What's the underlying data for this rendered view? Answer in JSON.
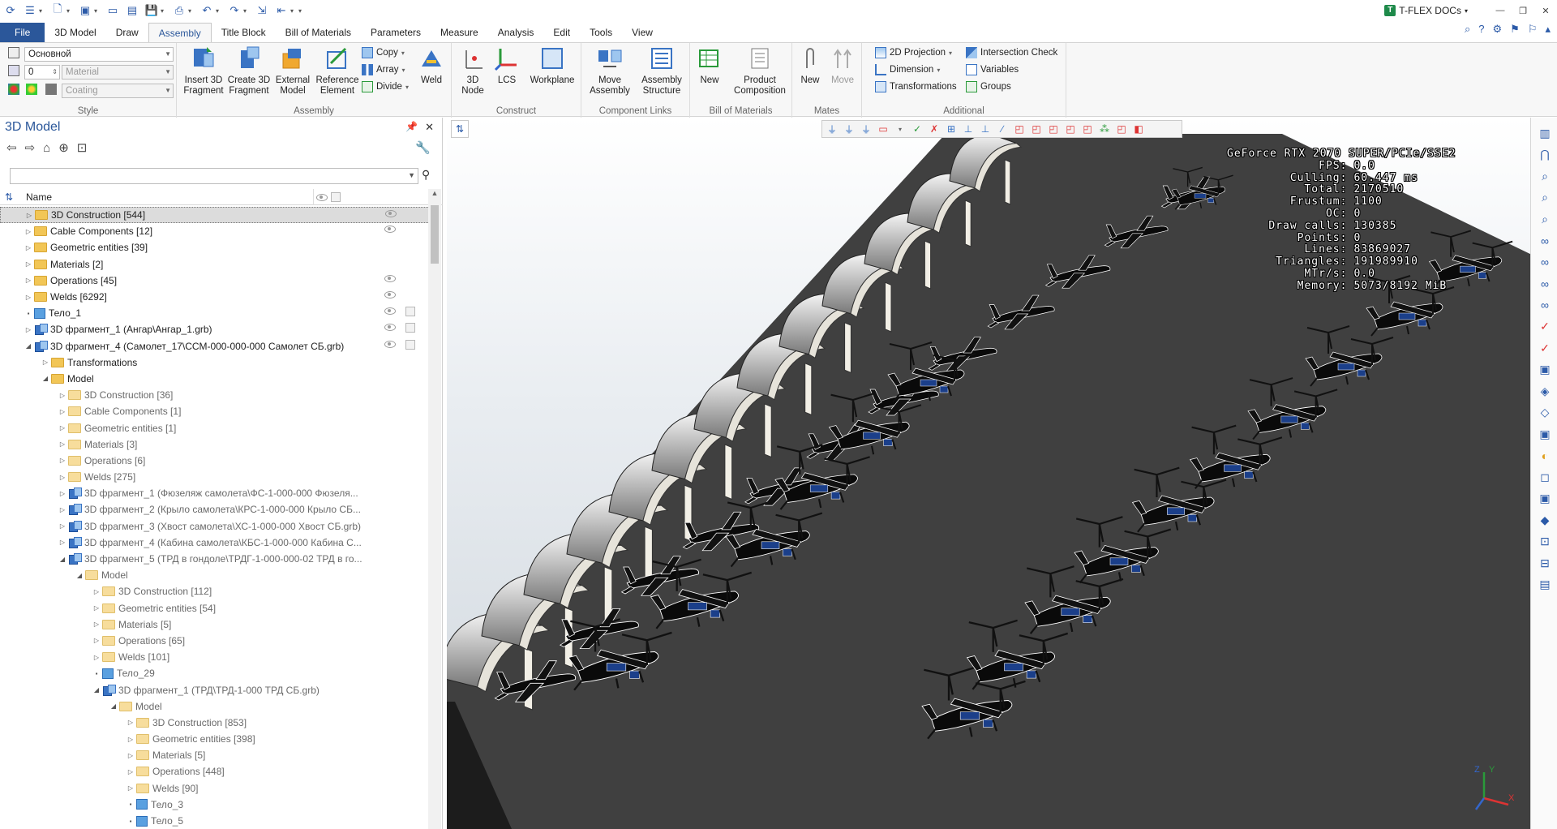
{
  "app": {
    "brand": "T-FLEX DOCs",
    "accent": "#2b579a"
  },
  "menu_tabs": [
    {
      "label": "File",
      "kind": "file"
    },
    {
      "label": "3D Model",
      "kind": ""
    },
    {
      "label": "Draw",
      "kind": ""
    },
    {
      "label": "Assembly",
      "kind": "active"
    },
    {
      "label": "Title Block",
      "kind": ""
    },
    {
      "label": "Bill of Materials",
      "kind": ""
    },
    {
      "label": "Parameters",
      "kind": ""
    },
    {
      "label": "Measure",
      "kind": ""
    },
    {
      "label": "Analysis",
      "kind": ""
    },
    {
      "label": "Edit",
      "kind": ""
    },
    {
      "label": "Tools",
      "kind": ""
    },
    {
      "label": "View",
      "kind": ""
    }
  ],
  "ribbon": {
    "style": {
      "group_label": "Style",
      "layer_value": "Основной",
      "level_value": "0",
      "material_placeholder": "Material",
      "coating_placeholder": "Coating"
    },
    "assembly": {
      "group_label": "Assembly",
      "insert_3d_fragment": "Insert 3D Fragment",
      "create_3d_fragment": "Create 3D Fragment",
      "external_model": "External Model",
      "reference_element": "Reference Element",
      "copy": "Copy",
      "array": "Array",
      "divide": "Divide",
      "weld": "Weld"
    },
    "construct": {
      "group_label": "Construct",
      "node_3d": "3D Node",
      "lcs": "LCS",
      "workplane": "Workplane"
    },
    "component_links": {
      "group_label": "Component Links",
      "move_assembly": "Move Assembly",
      "assembly_structure": "Assembly Structure"
    },
    "bill_of_materials": {
      "group_label": "Bill of Materials",
      "new": "New",
      "product_composition": "Product Composition"
    },
    "mates": {
      "group_label": "Mates",
      "new": "New",
      "move": "Move"
    },
    "additional": {
      "group_label": "Additional",
      "projection_2d": "2D Projection",
      "dimension": "Dimension",
      "transformations": "Transformations",
      "intersection_check": "Intersection Check",
      "variables": "Variables",
      "groups": "Groups"
    }
  },
  "model_panel": {
    "title": "3D Model",
    "column_name": "Name",
    "tree": [
      {
        "depth": 0,
        "icon": "folder",
        "toggle": "collapsed",
        "label": "3D Construction [544]",
        "selected": true,
        "eye": true,
        "copy": false
      },
      {
        "depth": 0,
        "icon": "folder",
        "toggle": "collapsed",
        "label": "Cable Components [12]",
        "eye": true
      },
      {
        "depth": 0,
        "icon": "folder",
        "toggle": "collapsed",
        "label": "Geometric entities [39]"
      },
      {
        "depth": 0,
        "icon": "folder",
        "toggle": "collapsed",
        "label": "Materials [2]"
      },
      {
        "depth": 0,
        "icon": "folder",
        "toggle": "collapsed",
        "label": "Operations [45]",
        "eye": true
      },
      {
        "depth": 0,
        "icon": "folder",
        "toggle": "collapsed",
        "label": "Welds [6292]",
        "eye": true
      },
      {
        "depth": 0,
        "icon": "body",
        "toggle": "leaf",
        "label": "Тело_1",
        "eye": true,
        "copy": true
      },
      {
        "depth": 0,
        "icon": "asm",
        "toggle": "collapsed",
        "label": "3D фрагмент_1 (Ангар\\Ангар_1.grb)",
        "eye": true,
        "copy": true
      },
      {
        "depth": 0,
        "icon": "asm2",
        "toggle": "expanded",
        "label": "3D фрагмент_4 (Самолет_17\\ССМ-000-000-000 Самолет СБ.grb)",
        "eye": true,
        "copy": true
      },
      {
        "depth": 1,
        "icon": "folder",
        "toggle": "collapsed",
        "label": "Transformations"
      },
      {
        "depth": 1,
        "icon": "folder",
        "toggle": "expanded",
        "label": "Model"
      },
      {
        "depth": 2,
        "icon": "folderg",
        "toggle": "collapsed",
        "label": "3D Construction [36]",
        "grey": true
      },
      {
        "depth": 2,
        "icon": "folderg",
        "toggle": "collapsed",
        "label": "Cable Components [1]",
        "grey": true
      },
      {
        "depth": 2,
        "icon": "folderg",
        "toggle": "collapsed",
        "label": "Geometric entities [1]",
        "grey": true
      },
      {
        "depth": 2,
        "icon": "folderg",
        "toggle": "collapsed",
        "label": "Materials [3]",
        "grey": true
      },
      {
        "depth": 2,
        "icon": "folderg",
        "toggle": "collapsed",
        "label": "Operations [6]",
        "grey": true
      },
      {
        "depth": 2,
        "icon": "folderg",
        "toggle": "collapsed",
        "label": "Welds [275]",
        "grey": true
      },
      {
        "depth": 2,
        "icon": "asm",
        "toggle": "collapsed",
        "label": "3D фрагмент_1 (Фюзеляж самолета\\ФС-1-000-000 Фюзеля...",
        "grey": true
      },
      {
        "depth": 2,
        "icon": "asm",
        "toggle": "collapsed",
        "label": "3D фрагмент_2 (Крыло самолета\\КРС-1-000-000 Крыло СБ...",
        "grey": true
      },
      {
        "depth": 2,
        "icon": "asm",
        "toggle": "collapsed",
        "label": "3D фрагмент_3 (Хвост самолета\\ХС-1-000-000 Хвост СБ.grb)",
        "grey": true
      },
      {
        "depth": 2,
        "icon": "asm",
        "toggle": "collapsed",
        "label": "3D фрагмент_4 (Кабина самолета\\КБС-1-000-000 Кабина С...",
        "grey": true
      },
      {
        "depth": 2,
        "icon": "asm",
        "toggle": "expanded",
        "label": "3D фрагмент_5 (ТРД в гондоле\\ТРДГ-1-000-000-02 ТРД в го...",
        "grey": true
      },
      {
        "depth": 3,
        "icon": "folderg",
        "toggle": "expanded",
        "label": "Model",
        "grey": true
      },
      {
        "depth": 4,
        "icon": "folderg",
        "toggle": "collapsed",
        "label": "3D Construction [112]",
        "grey": true
      },
      {
        "depth": 4,
        "icon": "folderg",
        "toggle": "collapsed",
        "label": "Geometric entities [54]",
        "grey": true
      },
      {
        "depth": 4,
        "icon": "folderg",
        "toggle": "collapsed",
        "label": "Materials [5]",
        "grey": true
      },
      {
        "depth": 4,
        "icon": "folderg",
        "toggle": "collapsed",
        "label": "Operations [65]",
        "grey": true
      },
      {
        "depth": 4,
        "icon": "folderg",
        "toggle": "collapsed",
        "label": "Welds [101]",
        "grey": true
      },
      {
        "depth": 4,
        "icon": "body",
        "toggle": "leaf",
        "label": "Тело_29",
        "grey": true
      },
      {
        "depth": 4,
        "icon": "asm",
        "toggle": "expanded",
        "label": "3D фрагмент_1 (ТРД\\ТРД-1-000 ТРД СБ.grb)",
        "grey": true
      },
      {
        "depth": 5,
        "icon": "folderg",
        "toggle": "expanded",
        "label": "Model",
        "grey": true
      },
      {
        "depth": 6,
        "icon": "folderg",
        "toggle": "collapsed",
        "label": "3D Construction [853]",
        "grey": true
      },
      {
        "depth": 6,
        "icon": "folderg",
        "toggle": "collapsed",
        "label": "Geometric entities [398]",
        "grey": true
      },
      {
        "depth": 6,
        "icon": "folderg",
        "toggle": "collapsed",
        "label": "Materials [5]",
        "grey": true
      },
      {
        "depth": 6,
        "icon": "folderg",
        "toggle": "collapsed",
        "label": "Operations [448]",
        "grey": true
      },
      {
        "depth": 6,
        "icon": "folderg",
        "toggle": "collapsed",
        "label": "Welds [90]",
        "grey": true
      },
      {
        "depth": 6,
        "icon": "body",
        "toggle": "leaf",
        "label": "Тело_3",
        "grey": true
      },
      {
        "depth": 6,
        "icon": "body",
        "toggle": "leaf",
        "label": "Тело_5",
        "grey": true
      }
    ]
  },
  "stats": [
    {
      "k": "GeForce RTX 2070 SUPER/PCIe/SSE2",
      "v": ""
    },
    {
      "k": "FPS:",
      "v": "0.0"
    },
    {
      "k": "Culling:",
      "v": "60.447 ms"
    },
    {
      "k": "Total:",
      "v": "2170510"
    },
    {
      "k": "Frustum:",
      "v": "1100"
    },
    {
      "k": "OC:",
      "v": "0"
    },
    {
      "k": "Draw calls:",
      "v": "130385"
    },
    {
      "k": "Points:",
      "v": "0"
    },
    {
      "k": "Lines:",
      "v": "83869027"
    },
    {
      "k": "Triangles:",
      "v": "191989910"
    },
    {
      "k": "MTr/s:",
      "v": "0.0"
    },
    {
      "k": "Memory:",
      "v": "5073/8192 MiB"
    }
  ],
  "axes": {
    "z": "Z",
    "y": "Y",
    "x": "X"
  }
}
